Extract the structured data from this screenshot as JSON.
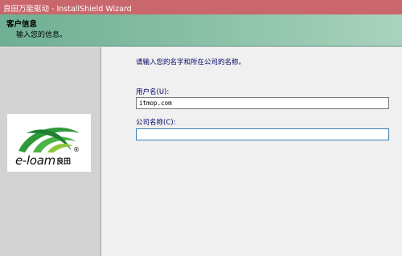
{
  "window": {
    "title": "良田万能驱动 - InstallShield Wizard"
  },
  "header": {
    "title": "客户信息",
    "subtitle": "输入您的信息。"
  },
  "logo": {
    "brand_text": "e-loam",
    "brand_cn": "良田",
    "registered": "®"
  },
  "form": {
    "prompt": "请输入您的名字和所在公司的名称。",
    "username_label": "用户名(U):",
    "username_value": "itmop.com",
    "company_label": "公司名称(C):",
    "company_value": ""
  },
  "colors": {
    "titlebar": "#c9676c",
    "header_green": "#86bea4",
    "logo_green": "#2e9a3c"
  }
}
